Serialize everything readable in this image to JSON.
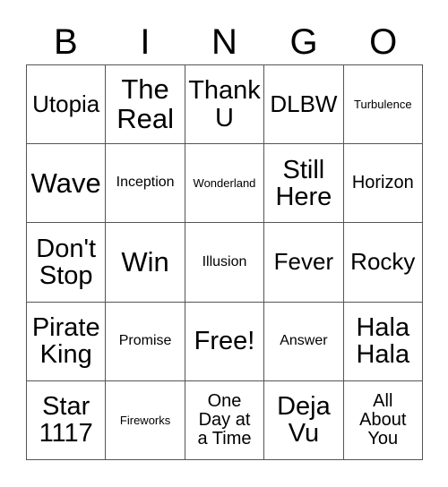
{
  "card": {
    "header": {
      "letters": [
        "B",
        "I",
        "N",
        "G",
        "O"
      ]
    },
    "colors": {
      "background": "#ffffff",
      "text": "#000000",
      "grid_line": "#555555"
    },
    "grid": {
      "columns": 5,
      "rows": 5,
      "cells": [
        [
          {
            "label": "Utopia",
            "size": "md"
          },
          {
            "label": "The\nReal",
            "size": "xl"
          },
          {
            "label": "Thank\nU",
            "size": "lg"
          },
          {
            "label": "DLBW",
            "size": "md"
          },
          {
            "label": "Turbulence",
            "size": "xxs"
          }
        ],
        [
          {
            "label": "Wave",
            "size": "xl"
          },
          {
            "label": "Inception",
            "size": "xs"
          },
          {
            "label": "Wonderland",
            "size": "xxs"
          },
          {
            "label": "Still\nHere",
            "size": "lg"
          },
          {
            "label": "Horizon",
            "size": "sm"
          }
        ],
        [
          {
            "label": "Don't\nStop",
            "size": "lg"
          },
          {
            "label": "Win",
            "size": "xl"
          },
          {
            "label": "Illusion",
            "size": "xs"
          },
          {
            "label": "Fever",
            "size": "md"
          },
          {
            "label": "Rocky",
            "size": "md"
          }
        ],
        [
          {
            "label": "Pirate\nKing",
            "size": "lg"
          },
          {
            "label": "Promise",
            "size": "xs"
          },
          {
            "label": "Free!",
            "size": "lg"
          },
          {
            "label": "Answer",
            "size": "xs"
          },
          {
            "label": "Hala\nHala",
            "size": "lg"
          }
        ],
        [
          {
            "label": "Star\n1117",
            "size": "lg"
          },
          {
            "label": "Fireworks",
            "size": "xxs"
          },
          {
            "label": "One\nDay at\na Time",
            "size": "sm"
          },
          {
            "label": "Deja\nVu",
            "size": "lg"
          },
          {
            "label": "All\nAbout\nYou",
            "size": "sm"
          }
        ]
      ]
    }
  }
}
